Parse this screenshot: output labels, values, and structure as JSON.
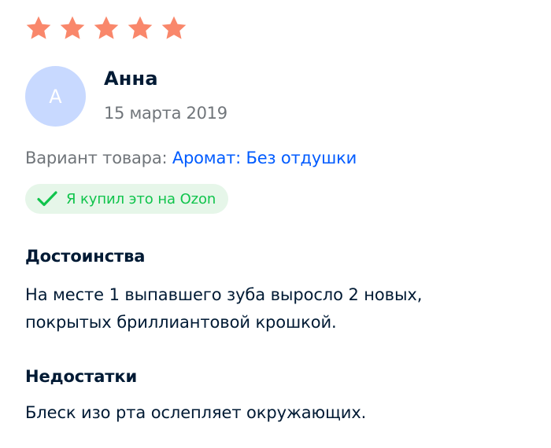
{
  "review": {
    "rating": 5,
    "rating_max": 5,
    "star_color": "#f9876b",
    "author": {
      "initial": "А",
      "name": "Анна",
      "avatar_color": "#c8d9ff"
    },
    "date": "15 марта 2019",
    "variant": {
      "label": "Вариант товара:",
      "value": "Аромат: Без отдушки"
    },
    "verified_badge": {
      "text": "Я купил это на Ozon",
      "icon": "checkmark-icon",
      "color": "#10c44c"
    },
    "pros": {
      "title": "Достоинства",
      "text": "На месте 1 выпавшего зуба выросло 2 новых, покрытых бриллиантовой крошкой."
    },
    "cons": {
      "title": "Недостатки",
      "text": "Блеск изо рта ослепляет окружающих."
    }
  }
}
